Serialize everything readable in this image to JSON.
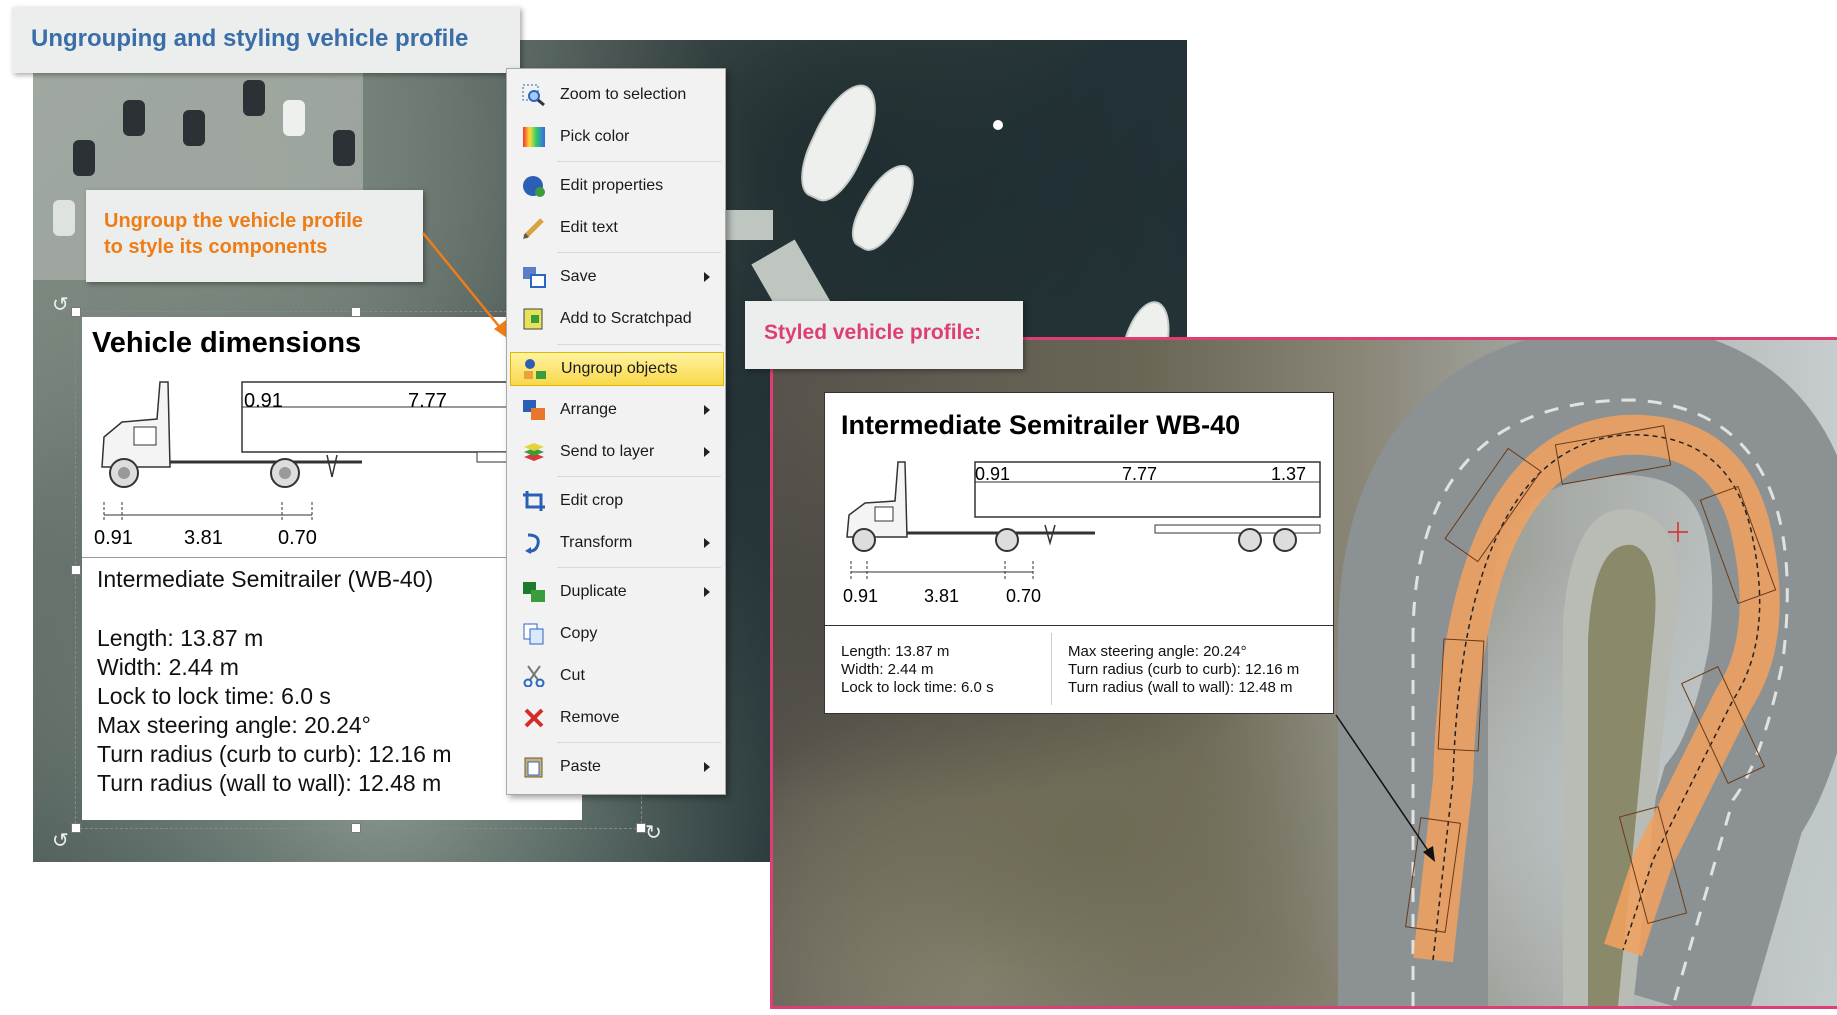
{
  "header": {
    "title": "Ungrouping and styling vehicle profile"
  },
  "callout_ungroup": {
    "line1": "Ungroup the vehicle profile",
    "line2": "to style its components"
  },
  "callout_styled": {
    "label": "Styled vehicle profile:"
  },
  "left_profile": {
    "title": "Vehicle dimensions",
    "dim_top": [
      "0.91",
      "7.77"
    ],
    "dim_bottom": [
      "0.91",
      "3.81",
      "0.70"
    ],
    "vehicle_name": "Intermediate Semitrailer (WB-40)",
    "specs": [
      "Length: 13.87 m",
      "Width: 2.44 m",
      "Lock to lock time: 6.0 s",
      "Max steering angle: 20.24°",
      "Turn radius (curb to curb): 12.16 m",
      "Turn radius (wall to wall): 12.48 m"
    ]
  },
  "context_menu": {
    "items": [
      {
        "label": "Zoom to selection",
        "icon": "zoom-selection-icon",
        "submenu": false
      },
      {
        "label": "Pick color",
        "icon": "color-palette-icon",
        "submenu": false
      },
      {
        "label": "Edit properties",
        "icon": "edit-properties-icon",
        "submenu": false
      },
      {
        "label": "Edit text",
        "icon": "pencil-icon",
        "submenu": false
      },
      {
        "label": "Save",
        "icon": "save-icon",
        "submenu": true
      },
      {
        "label": "Add to Scratchpad",
        "icon": "scratchpad-icon",
        "submenu": false
      },
      {
        "label": "Ungroup objects",
        "icon": "ungroup-icon",
        "submenu": false,
        "highlighted": true
      },
      {
        "label": "Arrange",
        "icon": "arrange-icon",
        "submenu": true
      },
      {
        "label": "Send to layer",
        "icon": "layers-icon",
        "submenu": true
      },
      {
        "label": "Edit crop",
        "icon": "crop-icon",
        "submenu": false
      },
      {
        "label": "Transform",
        "icon": "transform-icon",
        "submenu": true
      },
      {
        "label": "Duplicate",
        "icon": "duplicate-icon",
        "submenu": true
      },
      {
        "label": "Copy",
        "icon": "copy-icon",
        "submenu": false
      },
      {
        "label": "Cut",
        "icon": "scissors-icon",
        "submenu": false
      },
      {
        "label": "Remove",
        "icon": "remove-x-icon",
        "submenu": false
      },
      {
        "label": "Paste",
        "icon": "paste-icon",
        "submenu": true
      }
    ]
  },
  "styled_profile": {
    "title": "Intermediate Semitrailer WB-40",
    "dim_top": [
      "0.91",
      "7.77",
      "1.37"
    ],
    "dim_bottom": [
      "0.91",
      "3.81",
      "0.70"
    ],
    "specs_left": [
      "Length: 13.87 m",
      "Width: 2.44 m",
      "Lock to lock time: 6.0 s"
    ],
    "specs_right": [
      "Max steering angle: 20.24°",
      "Turn radius (curb to curb): 12.16 m",
      "Turn radius (wall to wall): 12.48 m"
    ]
  },
  "colors": {
    "title_blue": "#3a6ea8",
    "callout_orange": "#ee7d17",
    "callout_pink": "#de3f73",
    "vehicle_orange": "#f2a15e",
    "menu_highlight": "#f8d84a"
  }
}
